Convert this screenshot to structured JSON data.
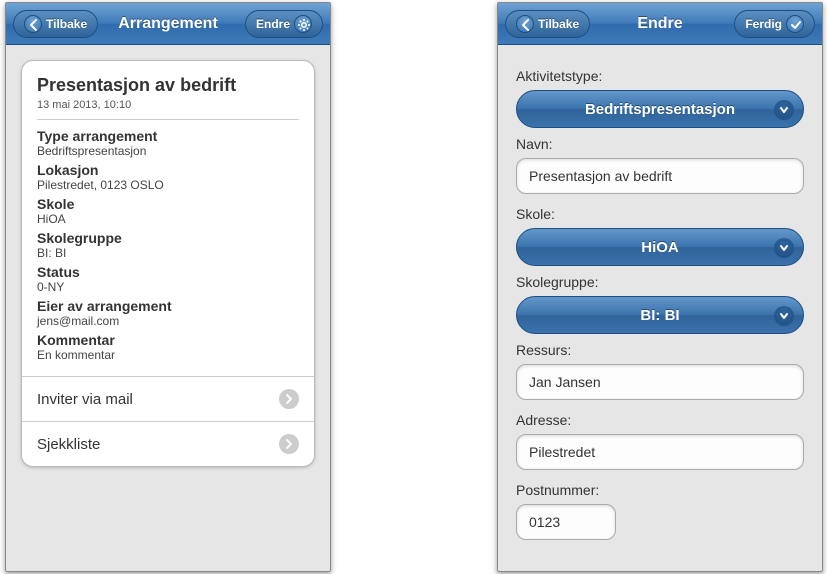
{
  "left": {
    "header": {
      "back": "Tilbake",
      "title": "Arrangement",
      "action": "Endre"
    },
    "card": {
      "title": "Presentasjon av bedrift",
      "subtitle": "13 mai 2013, 10:10",
      "fields": [
        {
          "label": "Type arrangement",
          "value": "Bedriftspresentasjon"
        },
        {
          "label": "Lokasjon",
          "value": "Pilestredet, 0123 OSLO"
        },
        {
          "label": "Skole",
          "value": "HiOA"
        },
        {
          "label": "Skolegruppe",
          "value": "BI: BI"
        },
        {
          "label": "Status",
          "value": "0-NY"
        },
        {
          "label": "Eier av arrangement",
          "value": "jens@mail.com"
        },
        {
          "label": "Kommentar",
          "value": "En kommentar"
        }
      ],
      "rows": [
        {
          "label": "Inviter via mail"
        },
        {
          "label": "Sjekkliste"
        }
      ]
    }
  },
  "right": {
    "header": {
      "back": "Tilbake",
      "title": "Endre",
      "action": "Ferdig"
    },
    "form": {
      "aktivitetstype_label": "Aktivitetstype:",
      "aktivitetstype_value": "Bedriftspresentasjon",
      "navn_label": "Navn:",
      "navn_value": "Presentasjon av bedrift",
      "skole_label": "Skole:",
      "skole_value": "HiOA",
      "skolegruppe_label": "Skolegruppe:",
      "skolegruppe_value": "BI: BI",
      "ressurs_label": "Ressurs:",
      "ressurs_value": "Jan Jansen",
      "adresse_label": "Adresse:",
      "adresse_value": "Pilestredet",
      "postnummer_label": "Postnummer:",
      "postnummer_value": "0123"
    }
  }
}
